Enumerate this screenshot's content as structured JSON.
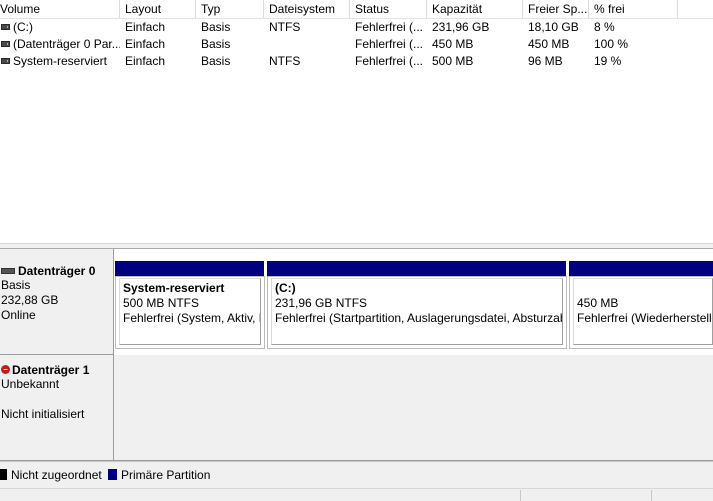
{
  "volume_list": {
    "columns": [
      "Volume",
      "Layout",
      "Typ",
      "Dateisystem",
      "Status",
      "Kapazität",
      "Freier Sp...",
      "% frei"
    ],
    "rows": [
      {
        "volume": "(C:)",
        "layout": "Einfach",
        "typ": "Basis",
        "dateisystem": "NTFS",
        "status": "Fehlerfrei (...",
        "kapazitaet": "231,96 GB",
        "frei": "18,10 GB",
        "prozent": "8 %"
      },
      {
        "volume": "(Datenträger 0 Par...",
        "layout": "Einfach",
        "typ": "Basis",
        "dateisystem": "",
        "status": "Fehlerfrei (...",
        "kapazitaet": "450 MB",
        "frei": "450 MB",
        "prozent": "100 %"
      },
      {
        "volume": "System-reserviert",
        "layout": "Einfach",
        "typ": "Basis",
        "dateisystem": "NTFS",
        "status": "Fehlerfrei (...",
        "kapazitaet": "500 MB",
        "frei": "96 MB",
        "prozent": "19 %"
      }
    ]
  },
  "disks": [
    {
      "name": "Datenträger 0",
      "type": "Basis",
      "size": "232,88 GB",
      "state": "Online",
      "partitions": [
        {
          "name": "System-reserviert",
          "size": "500 MB NTFS",
          "status": "Fehlerfrei (System, Aktiv, P"
        },
        {
          "name": "(C:)",
          "size": "231,96 GB NTFS",
          "status": "Fehlerfrei (Startpartition, Auslagerungsdatei, Absturzab"
        },
        {
          "name": "",
          "size": "450 MB",
          "status": "Fehlerfrei (Wiederherstellu"
        }
      ]
    },
    {
      "name": "Datenträger 1",
      "type": "Unbekannt",
      "size": "",
      "state": "Nicht initialisiert"
    }
  ],
  "legend": {
    "unallocated": "Nicht zugeordnet",
    "primary": "Primäre Partition"
  },
  "colors": {
    "primary_partition": "#010080",
    "unallocated": "#000000"
  },
  "icons": {
    "volume": "volume-icon",
    "disk": "disk-icon",
    "disk_error": "disk-error-icon"
  }
}
